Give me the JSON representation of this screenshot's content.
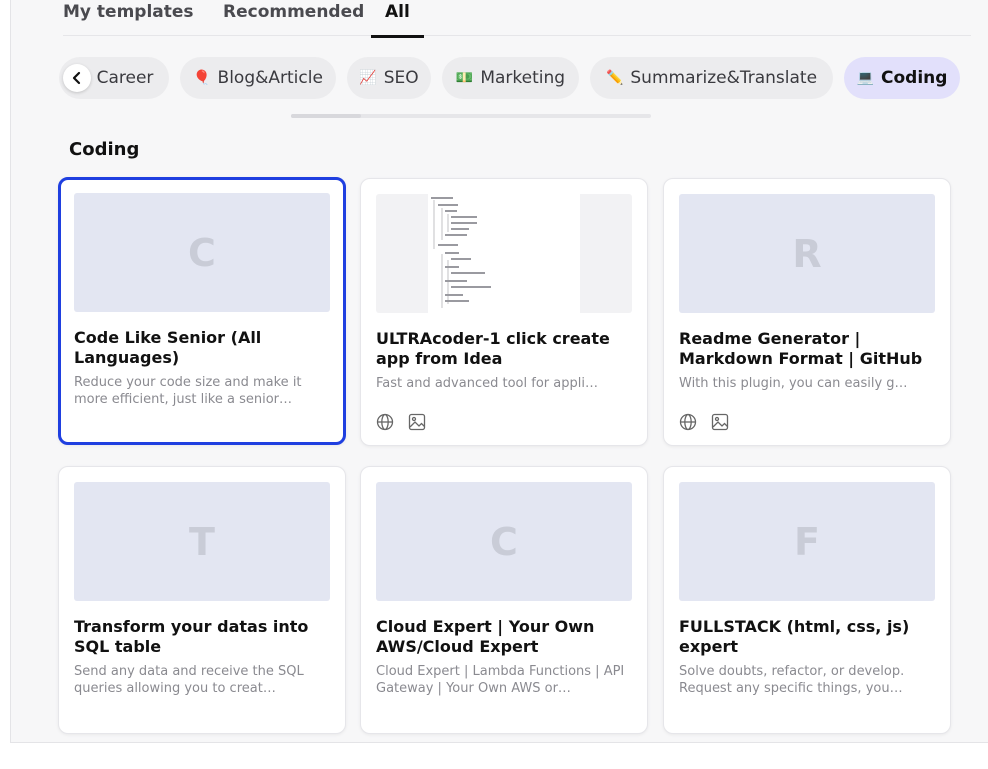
{
  "tabs": [
    {
      "label": "My templates",
      "active": false
    },
    {
      "label": "Recommended",
      "active": false
    },
    {
      "label": "All",
      "active": true
    }
  ],
  "chips": [
    {
      "label": "Career",
      "emoji": "",
      "active": false
    },
    {
      "label": "Blog&Article",
      "emoji": "🎈",
      "active": false
    },
    {
      "label": "SEO",
      "emoji": "📈",
      "active": false
    },
    {
      "label": "Marketing",
      "emoji": "💵",
      "active": false
    },
    {
      "label": "Summarize&Translate",
      "emoji": "✏️",
      "active": false
    },
    {
      "label": "Coding",
      "emoji": "💻",
      "active": true
    }
  ],
  "section": {
    "title": "Coding"
  },
  "cards": [
    {
      "letter": "C",
      "title": "Code Like Senior (All Languages)",
      "desc": "Reduce your code size and make it more efficient, just like a senior…",
      "icons": [],
      "selected": true
    },
    {
      "letter": "",
      "title": "ULTRAcoder-1 click create app from Idea",
      "desc": "Fast and advanced tool for appli…",
      "icons": [
        "globe-icon",
        "image-icon"
      ],
      "selected": false
    },
    {
      "letter": "R",
      "title": "Readme Generator | Markdown Format | GitHub",
      "desc": "With this plugin, you can easily g…",
      "icons": [
        "globe-icon",
        "image-icon"
      ],
      "selected": false
    },
    {
      "letter": "T",
      "title": "Transform your datas into SQL table",
      "desc": "Send any data and receive the SQL queries allowing you to creat…",
      "icons": [],
      "selected": false
    },
    {
      "letter": "C",
      "title": "Cloud Expert | Your Own AWS/Cloud Expert",
      "desc": "Cloud Expert | Lambda Functions | API Gateway | Your Own AWS or…",
      "icons": [],
      "selected": false
    },
    {
      "letter": "F",
      "title": "FULLSTACK (html, css, js) expert",
      "desc": "Solve doubts, refactor, or develop. Request any specific things, you…",
      "icons": [],
      "selected": false
    }
  ],
  "colors": {
    "accent": "#1f3fe0",
    "chip_active_bg": "#e2e0fb",
    "thumb_bg": "#e3e6f2"
  }
}
